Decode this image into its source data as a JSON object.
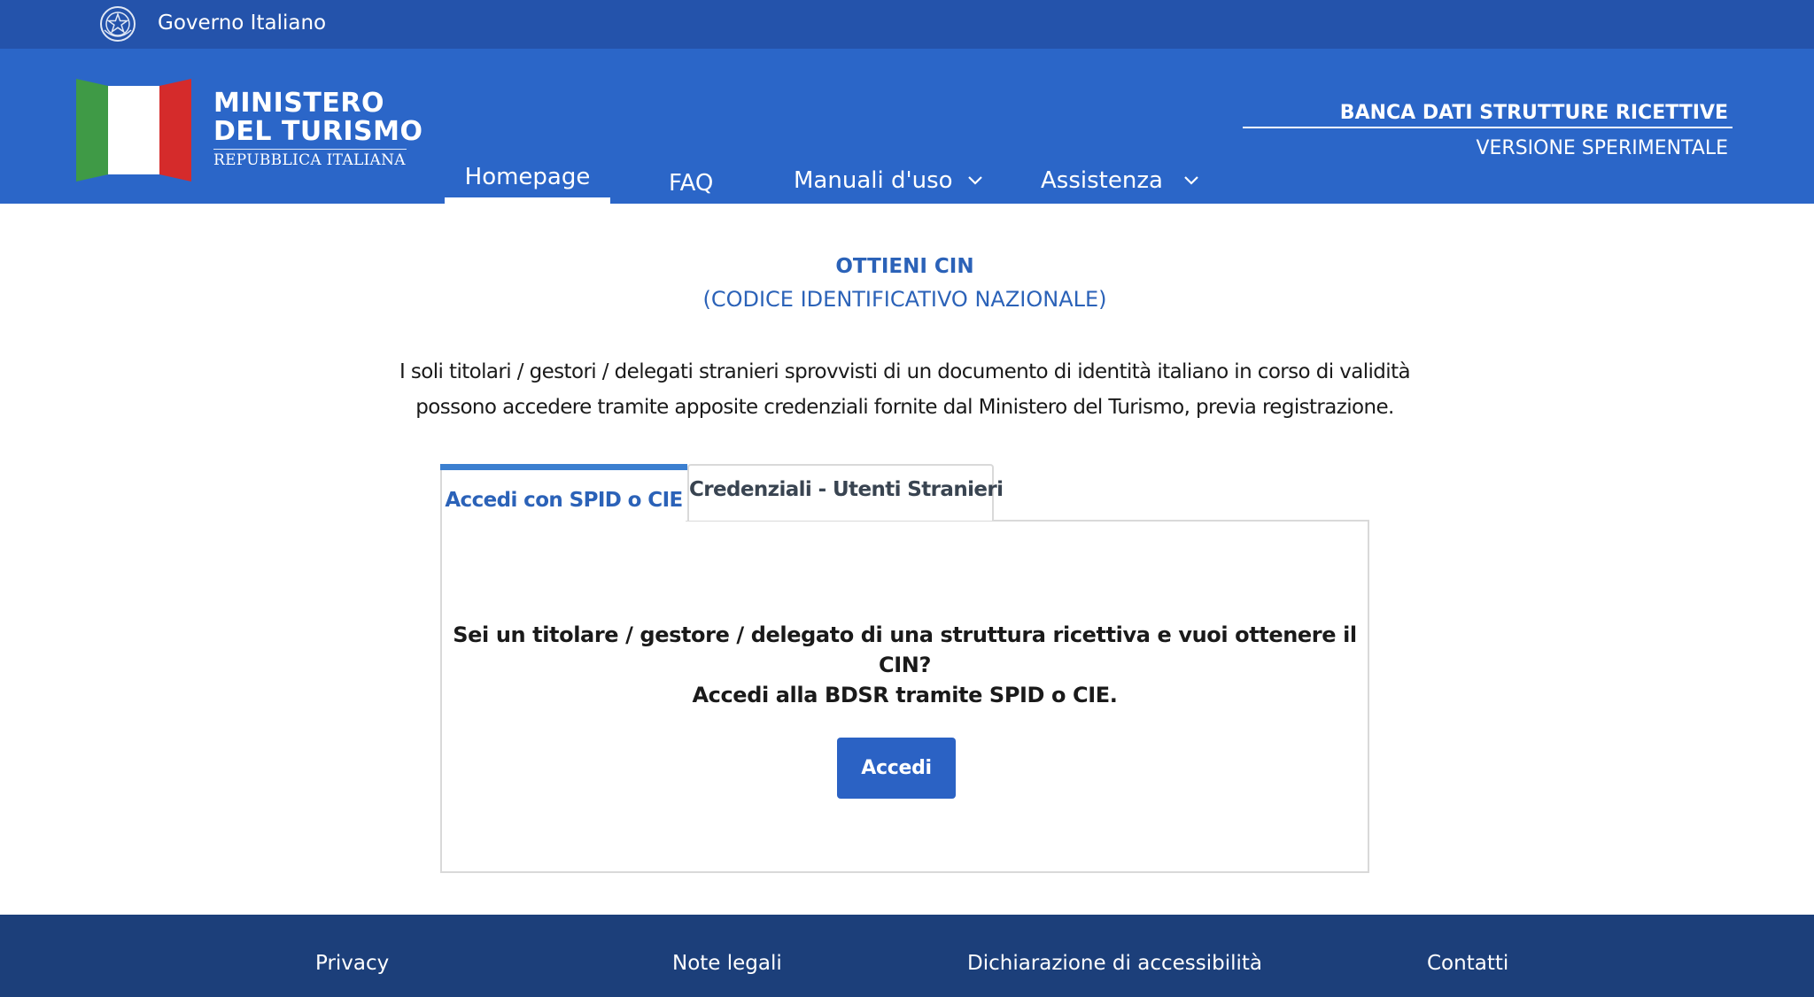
{
  "topbar": {
    "gov_label": "Governo Italiano",
    "emblem_icon": "italian-republic-emblem-icon"
  },
  "header": {
    "logo": {
      "line1": "MINISTERO",
      "line2": "DEL TURISMO",
      "line3": "REPUBBLICA ITALIANA",
      "flag_colors": [
        "#3f9a46",
        "#ffffff",
        "#d52b2b"
      ]
    },
    "nav": {
      "homepage": "Homepage",
      "faq": "FAQ",
      "manuali": "Manuali d'uso",
      "assistenza": "Assistenza"
    },
    "bdsr_title": "BANCA DATI STRUTTURE RICETTIVE",
    "bdsr_subtitle": "VERSIONE SPERIMENTALE"
  },
  "main": {
    "title": "OTTIENI CIN",
    "subtitle": "(CODICE IDENTIFICATIVO NAZIONALE)",
    "intro_line1": "I soli titolari / gestori / delegati stranieri sprovvisti di un documento di identità italiano in corso di validità",
    "intro_line2": "possono accedere tramite apposite credenziali fornite dal Ministero del Turismo, previa registrazione.",
    "tabs": {
      "spid": "Accedi con SPID o CIE",
      "credenziali": "Credenziali - Utenti Stranieri"
    },
    "panel": {
      "line1": "Sei un titolare / gestore / delegato di una struttura ricettiva e vuoi ottenere il CIN?",
      "line2": "Accedi alla BDSR tramite SPID o CIE.",
      "button": "Accedi"
    }
  },
  "footer": {
    "privacy": "Privacy",
    "note_legali": "Note legali",
    "accessibilita": "Dichiarazione di accessibilità",
    "contatti": "Contatti"
  },
  "colors": {
    "topbar": "#2453ab",
    "header": "#2b66c8",
    "accent": "#2b62b8",
    "footer": "#1c3f7a"
  }
}
